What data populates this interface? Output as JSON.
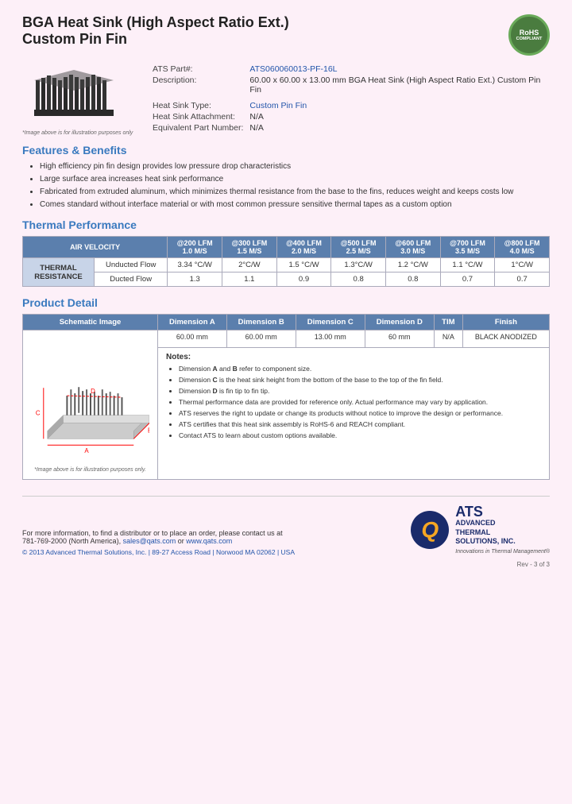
{
  "header": {
    "title_line1": "BGA Heat Sink (High Aspect Ratio Ext.)",
    "title_line2": "Custom Pin Fin",
    "rohs": {
      "line1": "RoHS",
      "line2": "COMPLIANT"
    }
  },
  "product_info": {
    "ats_part_label": "ATS Part#:",
    "ats_part_value": "ATS060060013-PF-16L",
    "description_label": "Description:",
    "description_value": "60.00 x 60.00 x 13.00 mm BGA Heat Sink (High Aspect Ratio Ext.) Custom Pin Fin",
    "heat_sink_type_label": "Heat Sink Type:",
    "heat_sink_type_value": "Custom Pin Fin",
    "heat_sink_attachment_label": "Heat Sink Attachment:",
    "heat_sink_attachment_value": "N/A",
    "equivalent_part_label": "Equivalent Part Number:",
    "equivalent_part_value": "N/A",
    "image_caption": "*Image above is for illustration purposes only"
  },
  "features": {
    "heading": "Features & Benefits",
    "items": [
      "High efficiency pin fin design provides low pressure drop characteristics",
      "Large surface area increases heat sink performance",
      "Fabricated from extruded aluminum, which minimizes thermal resistance from the base to the fins, reduces weight and keeps costs low",
      "Comes standard without interface material or with most common pressure sensitive thermal tapes as a custom option"
    ]
  },
  "thermal_performance": {
    "heading": "Thermal Performance",
    "air_velocity_label": "AIR VELOCITY",
    "columns": [
      "@200 LFM\n1.0 M/S",
      "@300 LFM\n1.5 M/S",
      "@400 LFM\n2.0 M/S",
      "@500 LFM\n2.5 M/S",
      "@600 LFM\n3.0 M/S",
      "@700 LFM\n3.5 M/S",
      "@800 LFM\n4.0 M/S"
    ],
    "row_label": "THERMAL RESISTANCE",
    "rows": [
      {
        "label": "Unducted Flow",
        "values": [
          "3.34 °C/W",
          "2°C/W",
          "1.5 °C/W",
          "1.3°C/W",
          "1.2 °C/W",
          "1.1 °C/W",
          "1°C/W"
        ]
      },
      {
        "label": "Ducted Flow",
        "values": [
          "1.3",
          "1.1",
          "0.9",
          "0.8",
          "0.8",
          "0.7",
          "0.7"
        ]
      }
    ]
  },
  "product_detail": {
    "heading": "Product Detail",
    "schematic_label": "Schematic Image",
    "columns": [
      "Dimension A",
      "Dimension B",
      "Dimension C",
      "Dimension D",
      "TIM",
      "Finish"
    ],
    "values": [
      "60.00 mm",
      "60.00 mm",
      "13.00 mm",
      "60 mm",
      "N/A",
      "BLACK ANODIZED"
    ],
    "schematic_caption": "*Image above is for illustration purposes only.",
    "notes_heading": "Notes:",
    "notes": [
      "Dimension A and B refer to component size.",
      "Dimension C is the heat sink height from the bottom of the base to the top of the fin field.",
      "Dimension D is fin tip to fin tip.",
      "Thermal performance data are provided for reference only. Actual performance may vary by application.",
      "ATS reserves the right to update or change its products without notice to improve the design or performance.",
      "ATS certifies that this heat sink assembly is RoHS-6 and REACH compliant.",
      "Contact ATS to learn about custom options available."
    ]
  },
  "footer": {
    "contact_line": "For more information, to find a distributor or to place an order, please contact us at",
    "phone": "781-769-2000 (North America)",
    "email": "sales@qats.com",
    "website": "www.qats.com",
    "copyright": "© 2013 Advanced Thermal Solutions, Inc. | 89-27 Access Road | Norwood MA  02062 | USA",
    "ats_name_line1": "ADVANCED",
    "ats_name_line2": "THERMAL",
    "ats_name_line3": "SOLUTIONS, INC.",
    "ats_tagline": "Innovations in Thermal Management®",
    "page_number": "Rev - 3 of 3"
  }
}
